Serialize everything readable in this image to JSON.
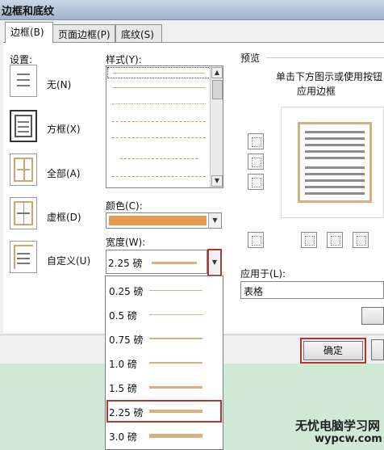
{
  "window": {
    "title": "边框和底纹"
  },
  "tabs": [
    {
      "label": "边框(B)",
      "active": true
    },
    {
      "label": "页面边框(P)",
      "active": false
    },
    {
      "label": "底纹(S)",
      "active": false
    }
  ],
  "settings": {
    "heading": "设置:",
    "items": [
      {
        "label": "无(N)",
        "icon": "setting-none-icon"
      },
      {
        "label": "方框(X)",
        "icon": "setting-box-icon",
        "selected": true
      },
      {
        "label": "全部(A)",
        "icon": "setting-all-icon"
      },
      {
        "label": "虚框(D)",
        "icon": "setting-grid-icon"
      },
      {
        "label": "自定义(U)",
        "icon": "setting-custom-icon"
      }
    ]
  },
  "style": {
    "heading": "样式(Y):"
  },
  "color": {
    "heading": "颜色(C):",
    "value": "#e69a4c"
  },
  "width": {
    "heading": "宽度(W):",
    "value": "2.25 磅",
    "options": [
      "0.25 磅",
      "0.5 磅",
      "0.75 磅",
      "1.0 磅",
      "1.5 磅",
      "2.25 磅",
      "3.0 磅"
    ],
    "selected_index": 5
  },
  "preview": {
    "heading": "预览",
    "hint_line1": "单击下方图示或使用按钮",
    "hint_line2": "应用边框"
  },
  "apply_to": {
    "heading": "应用于(L):",
    "value": "表格"
  },
  "buttons": {
    "ok": "确定"
  },
  "watermark": {
    "line1": "无忧电脑学习网",
    "line2": "wypcw.com"
  },
  "colors": {
    "accent_border": "#b03636",
    "line_color": "#d8b07f",
    "border_color": "#e69a4c"
  }
}
